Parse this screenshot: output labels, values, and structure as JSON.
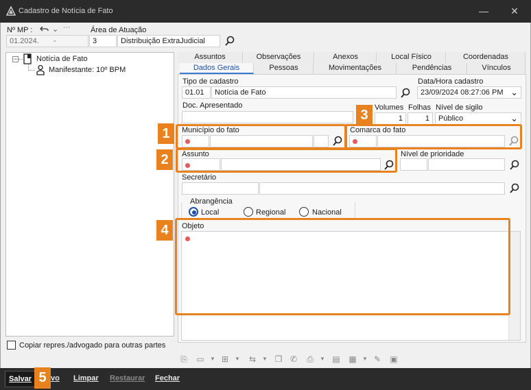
{
  "window": {
    "title": "Cadastro de Notícia de Fato"
  },
  "header": {
    "mp_label": "Nº MP :",
    "mp_value_a": "01.2024.",
    "mp_value_b": "-",
    "area_label": "Área de Atuação",
    "area_code": "3",
    "area_name": "Distribuição ExtraJudicial"
  },
  "tree": {
    "root": "Notícia de Fato",
    "child": "Manifestante: 10º BPM"
  },
  "tabs_top": [
    "Assuntos",
    "Observações",
    "Anexos",
    "Local Físico",
    "Coordenadas"
  ],
  "tabs_bottom": [
    "Dados Gerais",
    "Pessoas",
    "Movimentações",
    "Pendências",
    "Vínculos"
  ],
  "form": {
    "tipo_label": "Tipo de cadastro",
    "tipo_code": "01.01",
    "tipo_name": "Notícia de Fato",
    "data_label": "Data/Hora cadastro",
    "data_value": "23/09/2024 08:27:06 PM",
    "doc_label": "Doc. Apresentado",
    "volumes_label": "Volumes",
    "volumes_value": "1",
    "folhas_label": "Folhas",
    "folhas_value": "1",
    "sigilo_label": "Nível de sigilo",
    "sigilo_value": "Público",
    "municipio_label": "Município do fato",
    "comarca_label": "Comarca do fato",
    "assunto_label": "Assunto",
    "prioridade_label": "Nível de prioridade",
    "secretario_label": "Secretário",
    "abrangencia_label": "Abrangência",
    "abrangencia_options": [
      "Local",
      "Regional",
      "Nacional"
    ],
    "objeto_label": "Objeto"
  },
  "badges": [
    "1",
    "2",
    "3",
    "4",
    "5"
  ],
  "copiar_label": "Copiar repres./advogado para outras partes",
  "footer": {
    "salvar": "Salvar",
    "novo": "vo",
    "limpar": "Limpar",
    "restaurar": "Restaurar",
    "fechar": "Fechar"
  },
  "colors": {
    "highlight": "#e8821e",
    "required": "#e85a5a",
    "titlebar": "#2b2b2b",
    "active_tab": "#1e4fa8"
  }
}
